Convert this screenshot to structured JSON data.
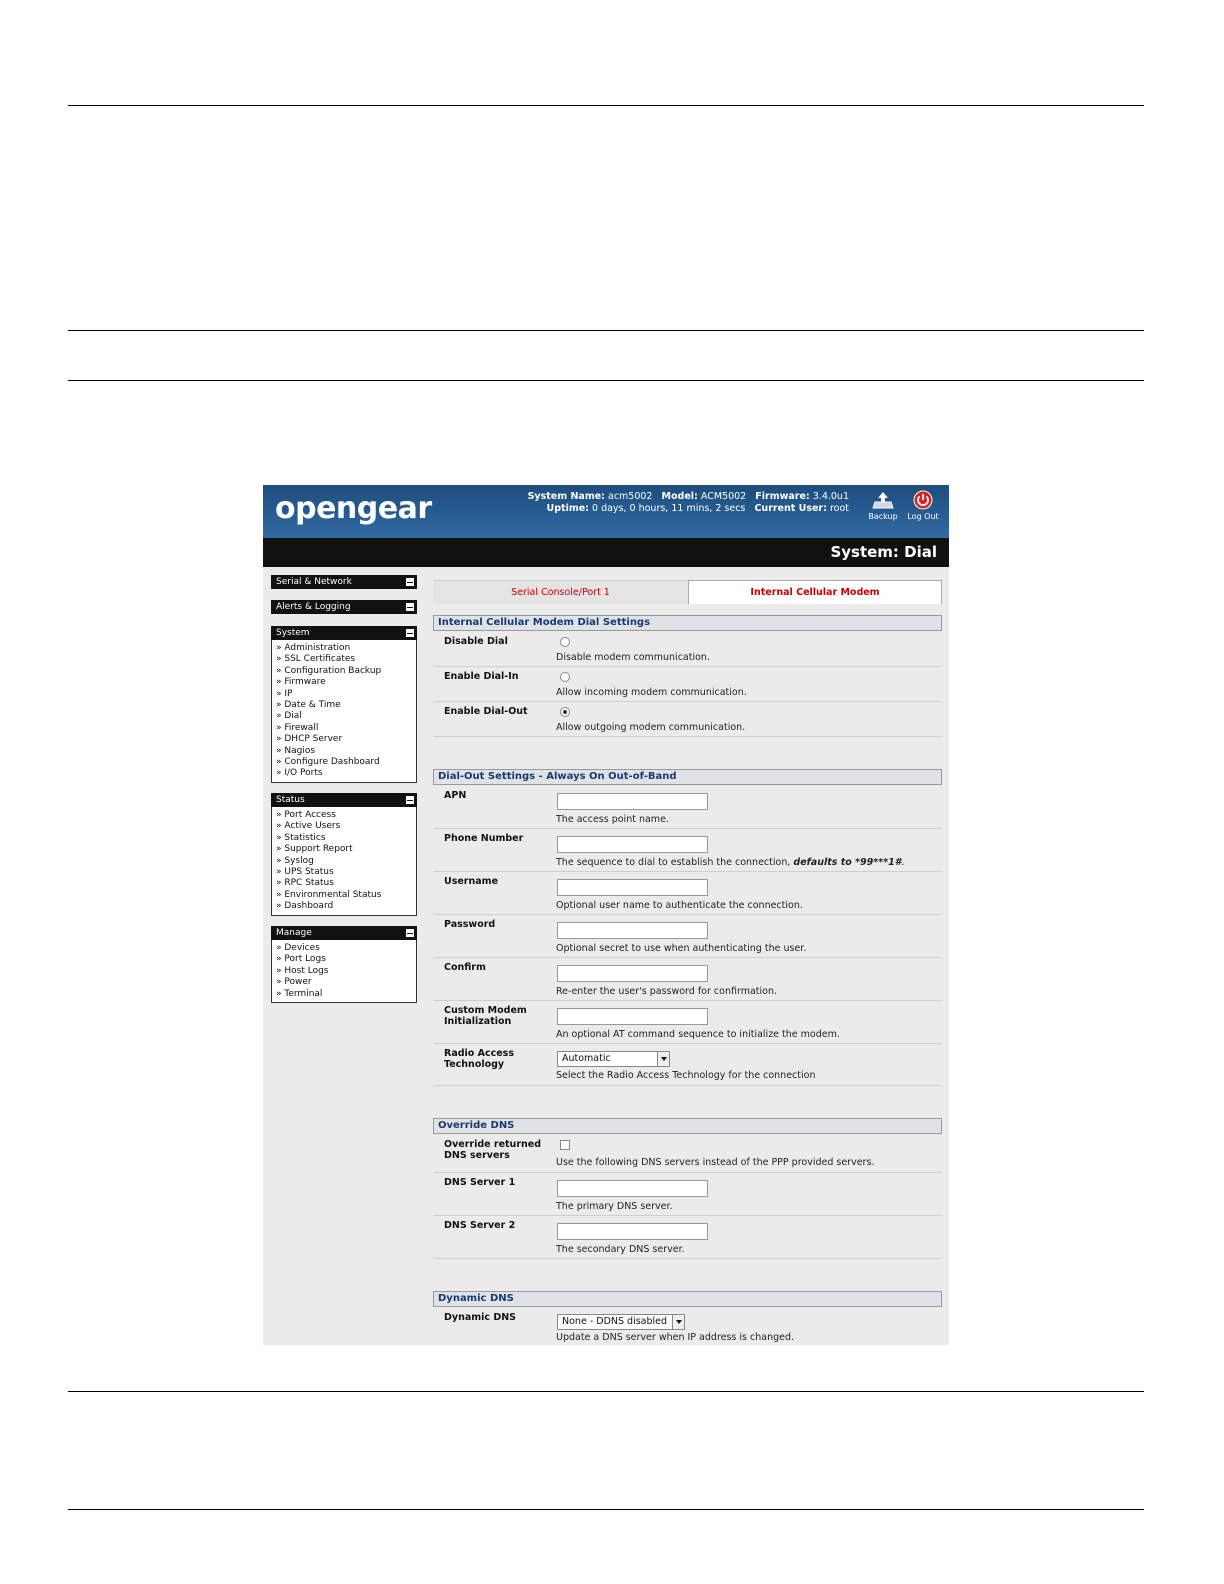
{
  "header": {
    "logo": "opengear",
    "system_name_label": "System Name:",
    "system_name": "acm5002",
    "model_label": "Model:",
    "model": "ACM5002",
    "firmware_label": "Firmware:",
    "firmware": "3.4.0u1",
    "uptime_label": "Uptime:",
    "uptime": "0 days, 0 hours, 11 mins, 2 secs",
    "current_user_label": "Current User:",
    "current_user": "root",
    "backup_label": "Backup",
    "logout_label": "Log Out"
  },
  "page_title": "System: Dial",
  "sidebar": {
    "serial_network": "Serial & Network",
    "alerts_logging": "Alerts & Logging",
    "system": {
      "title": "System",
      "items": [
        "Administration",
        "SSL Certificates",
        "Configuration Backup",
        "Firmware",
        "IP",
        "Date & Time",
        "Dial",
        "Firewall",
        "DHCP Server",
        "Nagios",
        "Configure Dashboard",
        "I/O Ports"
      ]
    },
    "status": {
      "title": "Status",
      "items": [
        "Port Access",
        "Active Users",
        "Statistics",
        "Support Report",
        "Syslog",
        "UPS Status",
        "RPC Status",
        "Environmental Status",
        "Dashboard"
      ]
    },
    "manage": {
      "title": "Manage",
      "items": [
        "Devices",
        "Port Logs",
        "Host Logs",
        "Power",
        "Terminal"
      ]
    }
  },
  "tabs": [
    "Serial Console/Port 1",
    "Internal Cellular Modem"
  ],
  "dial_settings": {
    "title": "Internal Cellular Modem Dial Settings",
    "options": [
      {
        "label": "Disable Dial",
        "hint": "Disable modem communication.",
        "selected": false
      },
      {
        "label": "Enable Dial-In",
        "hint": "Allow incoming modem communication.",
        "selected": false
      },
      {
        "label": "Enable Dial-Out",
        "hint": "Allow outgoing modem communication.",
        "selected": true
      }
    ]
  },
  "dialout": {
    "title": "Dial-Out Settings - Always On Out-of-Band",
    "apn": {
      "label": "APN",
      "hint": "The access point name.",
      "value": ""
    },
    "phone": {
      "label": "Phone Number",
      "hint": "The sequence to dial to establish the connection,",
      "hint_default": "defaults to *99***1#",
      "value": ""
    },
    "username": {
      "label": "Username",
      "hint": "Optional user name to authenticate the connection.",
      "value": ""
    },
    "password": {
      "label": "Password",
      "hint": "Optional secret to use when authenticating the user.",
      "value": ""
    },
    "confirm": {
      "label": "Confirm",
      "hint": "Re-enter the user's password for confirmation.",
      "value": ""
    },
    "custom_init": {
      "label_1": "Custom Modem",
      "label_2": "Initialization",
      "hint": "An optional AT command sequence to initialize the modem.",
      "value": ""
    },
    "rat": {
      "label_1": "Radio Access",
      "label_2": "Technology",
      "hint": "Select the Radio Access Technology for the connection",
      "value": "Automatic"
    }
  },
  "override_dns": {
    "title": "Override DNS",
    "override": {
      "label_1": "Override returned",
      "label_2": "DNS servers",
      "hint": "Use the following DNS servers instead of the PPP provided servers.",
      "checked": false
    },
    "dns1": {
      "label": "DNS Server 1",
      "hint": "The primary DNS server.",
      "value": ""
    },
    "dns2": {
      "label": "DNS Server 2",
      "hint": "The secondary DNS server.",
      "value": ""
    }
  },
  "dynamic_dns": {
    "title": "Dynamic DNS",
    "ddns": {
      "label": "Dynamic DNS",
      "value": "None - DDNS disabled",
      "hint": "Update a DNS server when IP address is changed."
    }
  }
}
